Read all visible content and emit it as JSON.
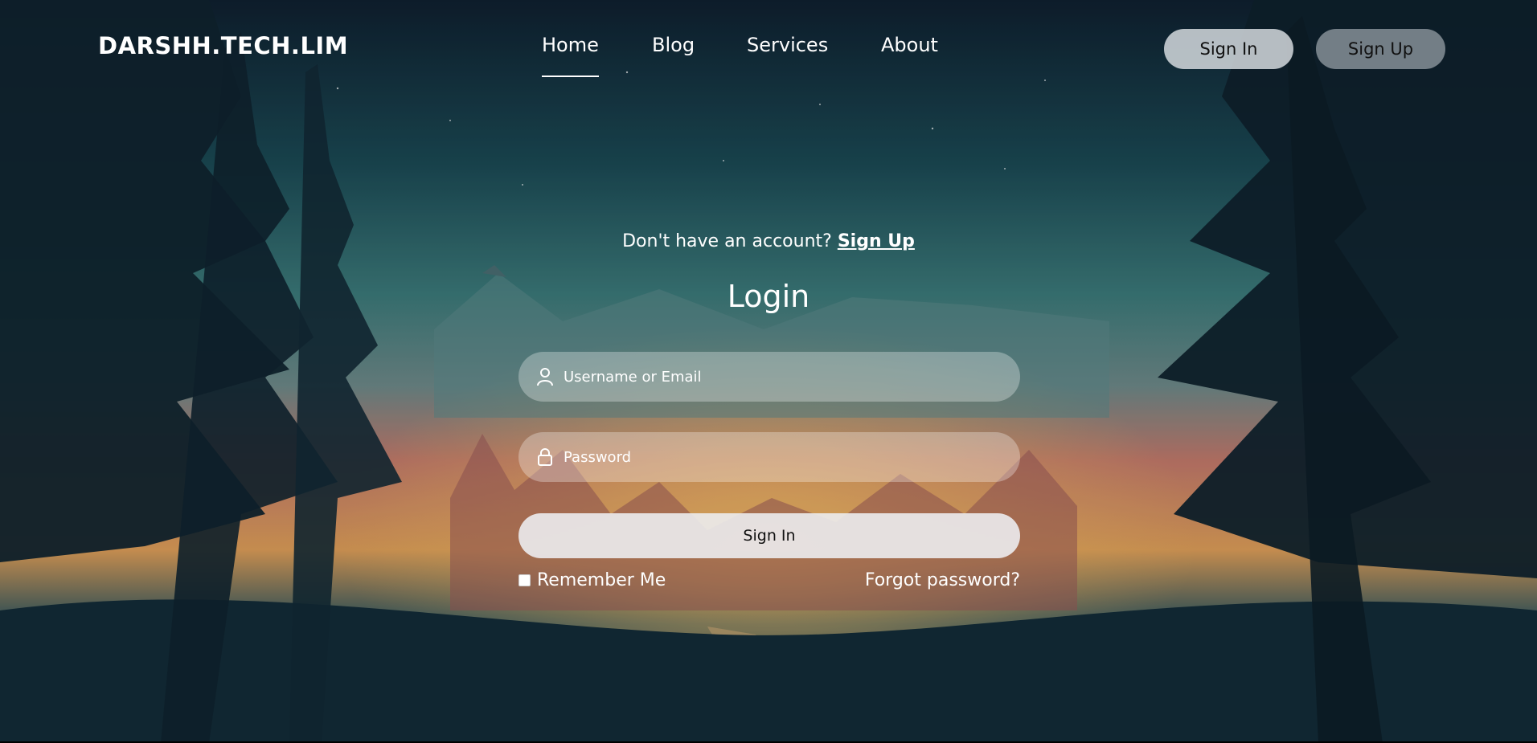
{
  "brand": {
    "name": "DARSHH.TECH.LIM"
  },
  "nav": {
    "items": [
      {
        "label": "Home",
        "active": true
      },
      {
        "label": "Blog",
        "active": false
      },
      {
        "label": "Services",
        "active": false
      },
      {
        "label": "About",
        "active": false
      }
    ]
  },
  "header_buttons": {
    "sign_in": "Sign In",
    "sign_up": "Sign Up"
  },
  "login": {
    "account_prompt": "Don't have an account?",
    "account_link": "Sign Up",
    "title": "Login",
    "username_placeholder": "Username or Email",
    "password_placeholder": "Password",
    "submit_label": "Sign In",
    "remember_label": "Remember Me",
    "remember_checked": false,
    "forgot_label": "Forgot password?"
  },
  "icons": {
    "username": "user-icon",
    "password": "lock-icon"
  }
}
